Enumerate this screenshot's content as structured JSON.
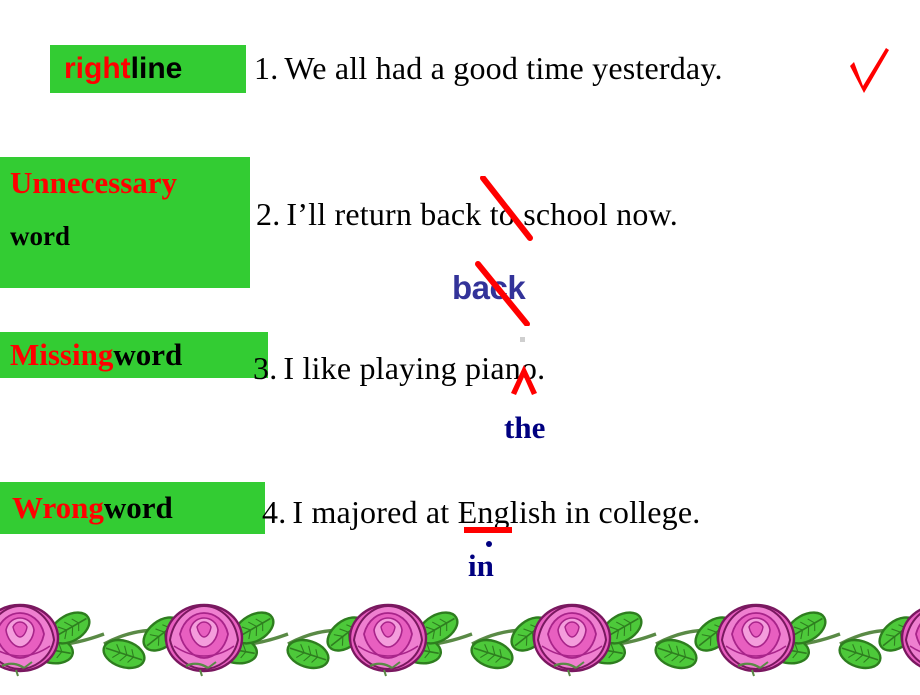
{
  "slide": {
    "background_color": "#ffffff",
    "accent_green": "#33cc33",
    "mark_red": "#ff0000",
    "correction_blue": "#000080"
  },
  "labels": [
    {
      "name": "right-line",
      "keyword": "right",
      "suffix": " line",
      "keyword_color": "#ff0000",
      "suffix_color": "#000000"
    },
    {
      "name": "unnecessary-word",
      "keyword": "Unnecessary",
      "suffix": "word",
      "keyword_color": "#ff0000",
      "suffix_color": "#000000"
    },
    {
      "name": "missing-word",
      "keyword": "Missing",
      "suffix": " word",
      "keyword_color": "#ff0000",
      "suffix_color": "#000000"
    },
    {
      "name": "wrong-word",
      "keyword": "Wrong",
      "suffix": " word",
      "keyword_color": "#ff0000",
      "suffix_color": "#000000"
    }
  ],
  "sentences": [
    {
      "number": "1.",
      "text": "We all had a good time yesterday.",
      "mark": "check-mark",
      "correction": null
    },
    {
      "number": "2.",
      "text": "I’ll return back to school now.",
      "mark": "strike-through",
      "correction": "back"
    },
    {
      "number": "3.",
      "text": "I like playing piano.",
      "mark": "caret-insert",
      "correction": "the"
    },
    {
      "number": "4.",
      "text": "I majored at English in college.",
      "mark": "underline",
      "correction": "in"
    }
  ],
  "marks": {
    "check": "check-mark-icon",
    "strike": "strike-through-icon",
    "caret": "caret-insert-icon",
    "underline": "underline-icon"
  },
  "decoration": {
    "name": "rose-vine-border",
    "rose_color": "#e85fc0",
    "rose_dark": "#c0299a",
    "leaf_color": "#4dc93a",
    "leaf_dark": "#2e7d1f",
    "stem_color": "#5a8a46"
  }
}
